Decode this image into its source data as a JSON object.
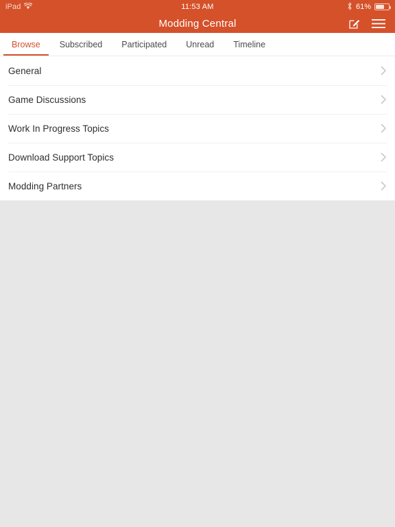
{
  "statusbar": {
    "device": "iPad",
    "wifi_icon": "wifi-icon",
    "time": "11:53 AM",
    "bluetooth_icon": "bluetooth-icon",
    "battery_percent": "61%",
    "battery_level": 61
  },
  "navbar": {
    "title": "Modding Central",
    "compose_icon": "compose-icon",
    "menu_icon": "hamburger-menu-icon"
  },
  "tabs": [
    {
      "label": "Browse",
      "active": true
    },
    {
      "label": "Subscribed",
      "active": false
    },
    {
      "label": "Participated",
      "active": false
    },
    {
      "label": "Unread",
      "active": false
    },
    {
      "label": "Timeline",
      "active": false
    }
  ],
  "forum_list": [
    {
      "label": "General",
      "chevron": "chevron-right-icon"
    },
    {
      "label": "Game Discussions",
      "chevron": "chevron-right-icon"
    },
    {
      "label": "Work In Progress Topics",
      "chevron": "chevron-right-icon"
    },
    {
      "label": "Download Support Topics",
      "chevron": "chevron-right-icon"
    },
    {
      "label": "Modding Partners",
      "chevron": "chevron-right-icon"
    }
  ],
  "colors": {
    "accent": "#d4512a",
    "navbar_bg": "#d4512a",
    "page_bg": "#e7e7e7",
    "list_bg": "#ffffff",
    "divider": "#f0f0f1",
    "row_text": "#2e2e2e",
    "tab_text": "#4a4a4a",
    "chevron": "#c9c9cd"
  }
}
